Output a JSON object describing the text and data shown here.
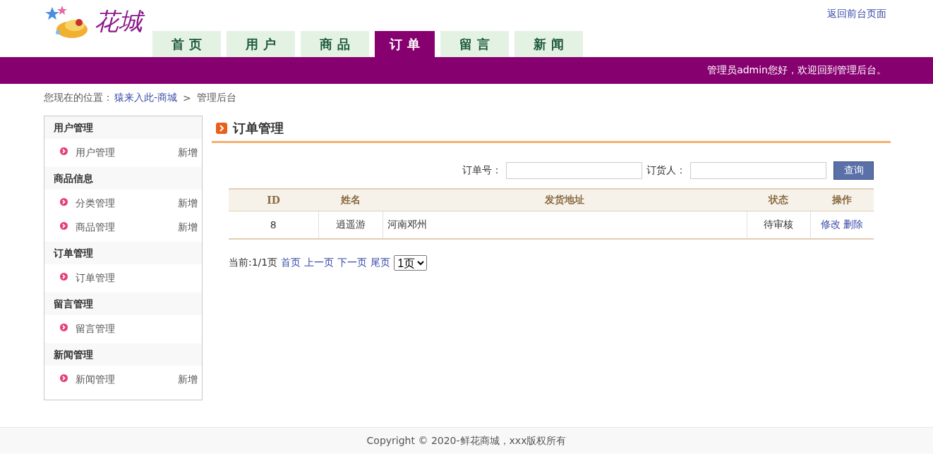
{
  "logo": {
    "text": "花城"
  },
  "top_link": "返回前台页面",
  "tabs": [
    {
      "label": "首 页",
      "selected": false
    },
    {
      "label": "用 户",
      "selected": false
    },
    {
      "label": "商 品",
      "selected": false
    },
    {
      "label": "订 单",
      "selected": true
    },
    {
      "label": "留 言",
      "selected": false
    },
    {
      "label": "新 闻",
      "selected": false
    }
  ],
  "welcome": "管理员admin您好，欢迎回到管理后台。",
  "breadcrumb": {
    "label": "您现在的位置：",
    "link": "猿来入此-商城",
    "separator": ">",
    "current": "管理后台"
  },
  "sidebar": [
    {
      "title": "用户管理",
      "items": [
        {
          "label": "用户管理",
          "action": "新增"
        }
      ]
    },
    {
      "title": "商品信息",
      "items": [
        {
          "label": "分类管理",
          "action": "新增"
        },
        {
          "label": "商品管理",
          "action": "新增"
        }
      ]
    },
    {
      "title": "订单管理",
      "items": [
        {
          "label": "订单管理"
        }
      ]
    },
    {
      "title": "留言管理",
      "items": [
        {
          "label": "留言管理"
        }
      ]
    },
    {
      "title": "新闻管理",
      "items": [
        {
          "label": "新闻管理",
          "action": "新增"
        }
      ]
    }
  ],
  "main": {
    "title": "订单管理",
    "search": {
      "order_label": "订单号：",
      "buyer_label": "订货人：",
      "button": "查询"
    },
    "table": {
      "columns": [
        "ID",
        "姓名",
        "发货地址",
        "状态",
        "操作"
      ],
      "rows": [
        {
          "id": "8",
          "name": "逍遥游",
          "address": "河南邓州",
          "status": "待审核",
          "actions": [
            "修改",
            "删除"
          ]
        }
      ]
    },
    "pager": {
      "info": "当前:1/1页",
      "links": [
        "首页",
        "上一页",
        "下一页",
        "尾页"
      ],
      "page": "1页"
    }
  },
  "footer": "Copyright © 2020-鲜花商城，xxx版权所有"
}
